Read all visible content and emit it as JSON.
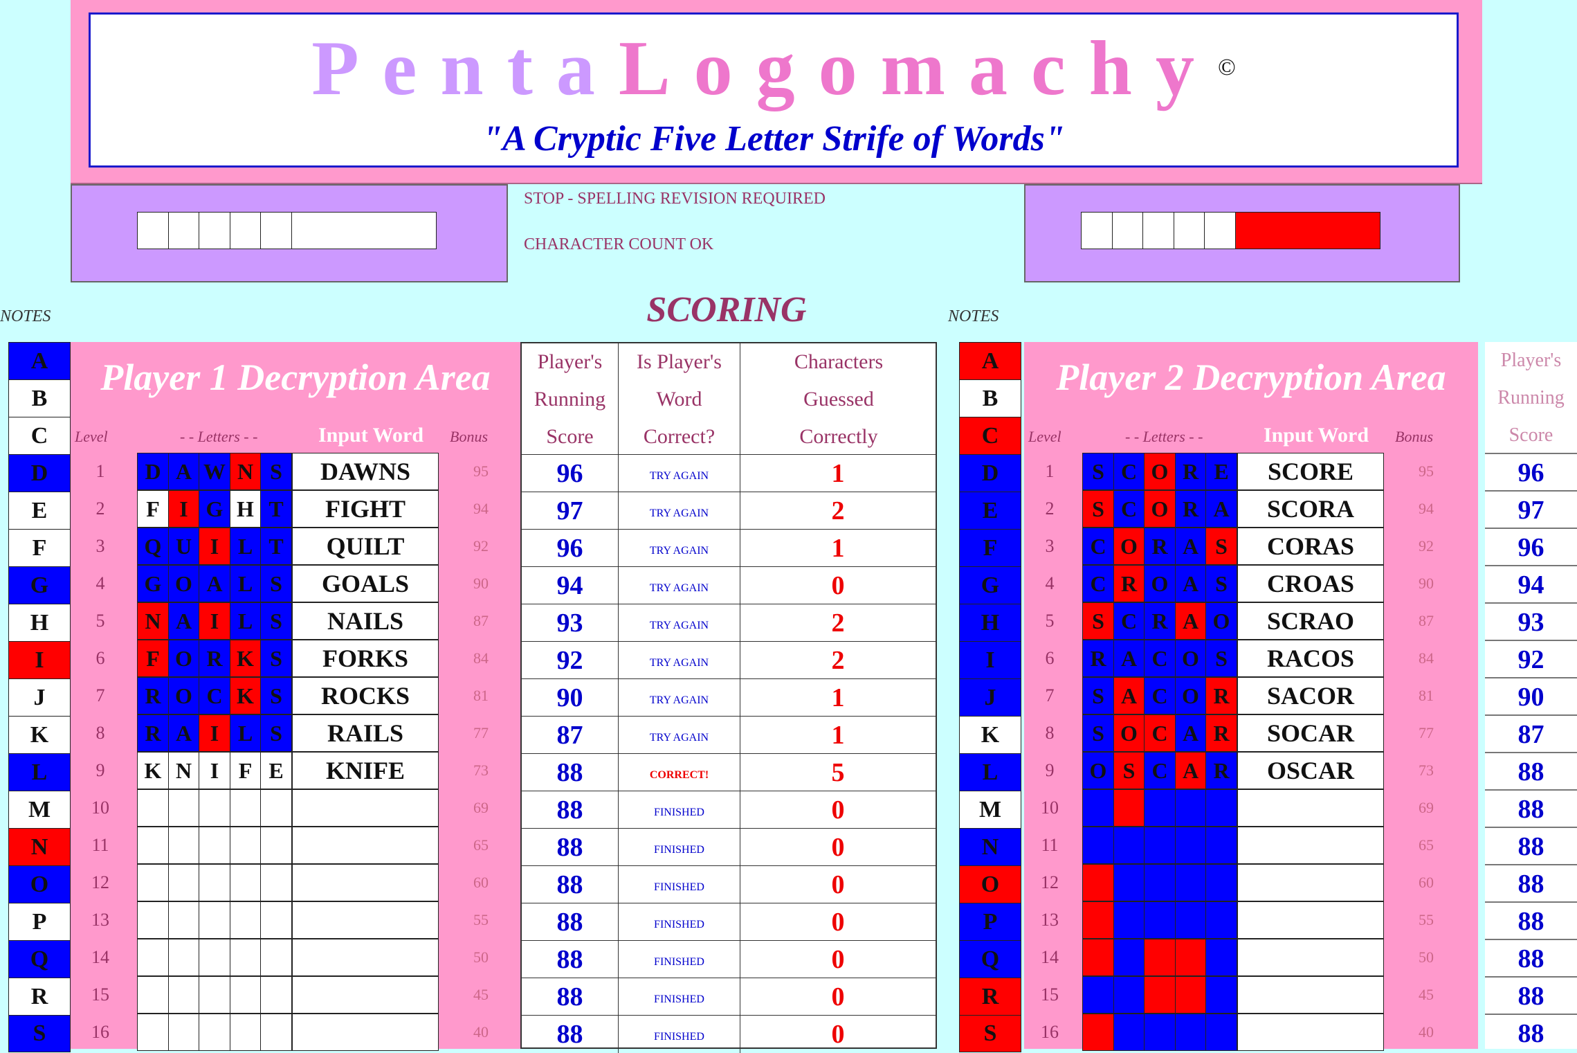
{
  "banner": {
    "title_part1": "Penta",
    "title_part2": "Logomachy",
    "copyright": "©",
    "subtitle": "\"A Cryptic Five Letter Strife of Words\""
  },
  "status": {
    "line1": "STOP - SPELLING REVISION REQUIRED",
    "line2": "CHARACTER COUNT OK"
  },
  "labels": {
    "notes": "NOTES",
    "scoring": "SCORING",
    "level": "Level",
    "letters": "- - Letters - -",
    "input_word": "Input Word",
    "bonus": "Bonus"
  },
  "player1": {
    "title": "Player 1 Decryption Area",
    "alphabet": [
      {
        "l": "A",
        "c": "blue"
      },
      {
        "l": "B",
        "c": "white"
      },
      {
        "l": "C",
        "c": "white"
      },
      {
        "l": "D",
        "c": "blue"
      },
      {
        "l": "E",
        "c": "white"
      },
      {
        "l": "F",
        "c": "white"
      },
      {
        "l": "G",
        "c": "blue"
      },
      {
        "l": "H",
        "c": "white"
      },
      {
        "l": "I",
        "c": "red"
      },
      {
        "l": "J",
        "c": "white"
      },
      {
        "l": "K",
        "c": "white"
      },
      {
        "l": "L",
        "c": "blue"
      },
      {
        "l": "M",
        "c": "white"
      },
      {
        "l": "N",
        "c": "red"
      },
      {
        "l": "O",
        "c": "blue"
      },
      {
        "l": "P",
        "c": "white"
      },
      {
        "l": "Q",
        "c": "blue"
      },
      {
        "l": "R",
        "c": "white"
      },
      {
        "l": "S",
        "c": "blue"
      }
    ],
    "rows": [
      {
        "level": "1",
        "letters": [
          [
            "D",
            "b"
          ],
          [
            "A",
            "b"
          ],
          [
            "W",
            "b"
          ],
          [
            "N",
            "r"
          ],
          [
            "S",
            "b"
          ]
        ],
        "word": "DAWNS",
        "bonus": "95"
      },
      {
        "level": "2",
        "letters": [
          [
            "F",
            "w"
          ],
          [
            "I",
            "r"
          ],
          [
            "G",
            "b"
          ],
          [
            "H",
            "w"
          ],
          [
            "T",
            "b"
          ]
        ],
        "word": "FIGHT",
        "bonus": "94"
      },
      {
        "level": "3",
        "letters": [
          [
            "Q",
            "b"
          ],
          [
            "U",
            "b"
          ],
          [
            "I",
            "r"
          ],
          [
            "L",
            "b"
          ],
          [
            "T",
            "b"
          ]
        ],
        "word": "QUILT",
        "bonus": "92"
      },
      {
        "level": "4",
        "letters": [
          [
            "G",
            "b"
          ],
          [
            "O",
            "b"
          ],
          [
            "A",
            "b"
          ],
          [
            "L",
            "b"
          ],
          [
            "S",
            "b"
          ]
        ],
        "word": "GOALS",
        "bonus": "90"
      },
      {
        "level": "5",
        "letters": [
          [
            "N",
            "r"
          ],
          [
            "A",
            "b"
          ],
          [
            "I",
            "r"
          ],
          [
            "L",
            "b"
          ],
          [
            "S",
            "b"
          ]
        ],
        "word": "NAILS",
        "bonus": "87"
      },
      {
        "level": "6",
        "letters": [
          [
            "F",
            "r"
          ],
          [
            "O",
            "b"
          ],
          [
            "R",
            "b"
          ],
          [
            "K",
            "r"
          ],
          [
            "S",
            "b"
          ]
        ],
        "word": "FORKS",
        "bonus": "84"
      },
      {
        "level": "7",
        "letters": [
          [
            "R",
            "b"
          ],
          [
            "O",
            "b"
          ],
          [
            "C",
            "b"
          ],
          [
            "K",
            "r"
          ],
          [
            "S",
            "b"
          ]
        ],
        "word": "ROCKS",
        "bonus": "81"
      },
      {
        "level": "8",
        "letters": [
          [
            "R",
            "b"
          ],
          [
            "A",
            "b"
          ],
          [
            "I",
            "r"
          ],
          [
            "L",
            "b"
          ],
          [
            "S",
            "b"
          ]
        ],
        "word": "RAILS",
        "bonus": "77"
      },
      {
        "level": "9",
        "letters": [
          [
            "K",
            "w"
          ],
          [
            "N",
            "w"
          ],
          [
            "I",
            "w"
          ],
          [
            "F",
            "w"
          ],
          [
            "E",
            "w"
          ]
        ],
        "word": "KNIFE",
        "bonus": "73"
      },
      {
        "level": "10",
        "letters": [
          [
            "",
            "w"
          ],
          [
            "",
            "w"
          ],
          [
            "",
            "w"
          ],
          [
            "",
            "w"
          ],
          [
            "",
            "w"
          ]
        ],
        "word": "",
        "bonus": "69"
      },
      {
        "level": "11",
        "letters": [
          [
            "",
            "w"
          ],
          [
            "",
            "w"
          ],
          [
            "",
            "w"
          ],
          [
            "",
            "w"
          ],
          [
            "",
            "w"
          ]
        ],
        "word": "",
        "bonus": "65"
      },
      {
        "level": "12",
        "letters": [
          [
            "",
            "w"
          ],
          [
            "",
            "w"
          ],
          [
            "",
            "w"
          ],
          [
            "",
            "w"
          ],
          [
            "",
            "w"
          ]
        ],
        "word": "",
        "bonus": "60"
      },
      {
        "level": "13",
        "letters": [
          [
            "",
            "w"
          ],
          [
            "",
            "w"
          ],
          [
            "",
            "w"
          ],
          [
            "",
            "w"
          ],
          [
            "",
            "w"
          ]
        ],
        "word": "",
        "bonus": "55"
      },
      {
        "level": "14",
        "letters": [
          [
            "",
            "w"
          ],
          [
            "",
            "w"
          ],
          [
            "",
            "w"
          ],
          [
            "",
            "w"
          ],
          [
            "",
            "w"
          ]
        ],
        "word": "",
        "bonus": "50"
      },
      {
        "level": "15",
        "letters": [
          [
            "",
            "w"
          ],
          [
            "",
            "w"
          ],
          [
            "",
            "w"
          ],
          [
            "",
            "w"
          ],
          [
            "",
            "w"
          ]
        ],
        "word": "",
        "bonus": "45"
      },
      {
        "level": "16",
        "letters": [
          [
            "",
            "w"
          ],
          [
            "",
            "w"
          ],
          [
            "",
            "w"
          ],
          [
            "",
            "w"
          ],
          [
            "",
            "w"
          ]
        ],
        "word": "",
        "bonus": "40"
      }
    ]
  },
  "score_table": {
    "headers": [
      "Player's Running Score",
      "Is Player's Word Correct?",
      "Characters Guessed Correctly"
    ],
    "header_lines": [
      [
        "Player's",
        "Running",
        "Score"
      ],
      [
        "Is Player's",
        "Word",
        "Correct?"
      ],
      [
        "Characters",
        "Guessed",
        "Correctly"
      ]
    ],
    "rows": [
      {
        "score": "96",
        "status": "TRY AGAIN",
        "kind": "try",
        "count": "1"
      },
      {
        "score": "97",
        "status": "TRY AGAIN",
        "kind": "try",
        "count": "2"
      },
      {
        "score": "96",
        "status": "TRY AGAIN",
        "kind": "try",
        "count": "1"
      },
      {
        "score": "94",
        "status": "TRY AGAIN",
        "kind": "try",
        "count": "0"
      },
      {
        "score": "93",
        "status": "TRY AGAIN",
        "kind": "try",
        "count": "2"
      },
      {
        "score": "92",
        "status": "TRY AGAIN",
        "kind": "try",
        "count": "2"
      },
      {
        "score": "90",
        "status": "TRY AGAIN",
        "kind": "try",
        "count": "1"
      },
      {
        "score": "87",
        "status": "TRY AGAIN",
        "kind": "try",
        "count": "1"
      },
      {
        "score": "88",
        "status": "CORRECT!",
        "kind": "cor",
        "count": "5"
      },
      {
        "score": "88",
        "status": "FINISHED",
        "kind": "fin",
        "count": "0"
      },
      {
        "score": "88",
        "status": "FINISHED",
        "kind": "fin",
        "count": "0"
      },
      {
        "score": "88",
        "status": "FINISHED",
        "kind": "fin",
        "count": "0"
      },
      {
        "score": "88",
        "status": "FINISHED",
        "kind": "fin",
        "count": "0"
      },
      {
        "score": "88",
        "status": "FINISHED",
        "kind": "fin",
        "count": "0"
      },
      {
        "score": "88",
        "status": "FINISHED",
        "kind": "fin",
        "count": "0"
      },
      {
        "score": "88",
        "status": "FINISHED",
        "kind": "fin",
        "count": "0"
      }
    ]
  },
  "player2": {
    "title": "Player 2 Decryption Area",
    "alphabet": [
      {
        "l": "A",
        "c": "red"
      },
      {
        "l": "B",
        "c": "white"
      },
      {
        "l": "C",
        "c": "red"
      },
      {
        "l": "D",
        "c": "blue"
      },
      {
        "l": "E",
        "c": "blue"
      },
      {
        "l": "F",
        "c": "blue"
      },
      {
        "l": "G",
        "c": "blue"
      },
      {
        "l": "H",
        "c": "blue"
      },
      {
        "l": "I",
        "c": "blue"
      },
      {
        "l": "J",
        "c": "blue"
      },
      {
        "l": "K",
        "c": "white"
      },
      {
        "l": "L",
        "c": "blue"
      },
      {
        "l": "M",
        "c": "white"
      },
      {
        "l": "N",
        "c": "blue"
      },
      {
        "l": "O",
        "c": "red"
      },
      {
        "l": "P",
        "c": "blue"
      },
      {
        "l": "Q",
        "c": "blue"
      },
      {
        "l": "R",
        "c": "red"
      },
      {
        "l": "S",
        "c": "red"
      }
    ],
    "rows": [
      {
        "level": "1",
        "letters": [
          [
            "S",
            "b"
          ],
          [
            "C",
            "b"
          ],
          [
            "O",
            "r"
          ],
          [
            "R",
            "b"
          ],
          [
            "E",
            "b"
          ]
        ],
        "word": "SCORE",
        "bonus": "95"
      },
      {
        "level": "2",
        "letters": [
          [
            "S",
            "r"
          ],
          [
            "C",
            "b"
          ],
          [
            "O",
            "r"
          ],
          [
            "R",
            "b"
          ],
          [
            "A",
            "b"
          ]
        ],
        "word": "SCORA",
        "bonus": "94"
      },
      {
        "level": "3",
        "letters": [
          [
            "C",
            "b"
          ],
          [
            "O",
            "r"
          ],
          [
            "R",
            "b"
          ],
          [
            "A",
            "b"
          ],
          [
            "S",
            "r"
          ]
        ],
        "word": "CORAS",
        "bonus": "92"
      },
      {
        "level": "4",
        "letters": [
          [
            "C",
            "b"
          ],
          [
            "R",
            "r"
          ],
          [
            "O",
            "b"
          ],
          [
            "A",
            "b"
          ],
          [
            "S",
            "b"
          ]
        ],
        "word": "CROAS",
        "bonus": "90"
      },
      {
        "level": "5",
        "letters": [
          [
            "S",
            "r"
          ],
          [
            "C",
            "b"
          ],
          [
            "R",
            "b"
          ],
          [
            "A",
            "r"
          ],
          [
            "O",
            "b"
          ]
        ],
        "word": "SCRAO",
        "bonus": "87"
      },
      {
        "level": "6",
        "letters": [
          [
            "R",
            "b"
          ],
          [
            "A",
            "b"
          ],
          [
            "C",
            "b"
          ],
          [
            "O",
            "b"
          ],
          [
            "S",
            "b"
          ]
        ],
        "word": "RACOS",
        "bonus": "84"
      },
      {
        "level": "7",
        "letters": [
          [
            "S",
            "b"
          ],
          [
            "A",
            "r"
          ],
          [
            "C",
            "b"
          ],
          [
            "O",
            "b"
          ],
          [
            "R",
            "r"
          ]
        ],
        "word": "SACOR",
        "bonus": "81"
      },
      {
        "level": "8",
        "letters": [
          [
            "S",
            "b"
          ],
          [
            "O",
            "r"
          ],
          [
            "C",
            "r"
          ],
          [
            "A",
            "b"
          ],
          [
            "R",
            "r"
          ]
        ],
        "word": "SOCAR",
        "bonus": "77"
      },
      {
        "level": "9",
        "letters": [
          [
            "O",
            "b"
          ],
          [
            "S",
            "r"
          ],
          [
            "C",
            "b"
          ],
          [
            "A",
            "r"
          ],
          [
            "R",
            "b"
          ]
        ],
        "word": "OSCAR",
        "bonus": "73"
      },
      {
        "level": "10",
        "letters": [
          [
            "",
            "b"
          ],
          [
            "",
            "r"
          ],
          [
            "",
            "b"
          ],
          [
            "",
            "b"
          ],
          [
            "",
            "b"
          ]
        ],
        "word": "",
        "bonus": "69"
      },
      {
        "level": "11",
        "letters": [
          [
            "",
            "b"
          ],
          [
            "",
            "b"
          ],
          [
            "",
            "b"
          ],
          [
            "",
            "b"
          ],
          [
            "",
            "b"
          ]
        ],
        "word": "",
        "bonus": "65"
      },
      {
        "level": "12",
        "letters": [
          [
            "",
            "r"
          ],
          [
            "",
            "b"
          ],
          [
            "",
            "b"
          ],
          [
            "",
            "b"
          ],
          [
            "",
            "b"
          ]
        ],
        "word": "",
        "bonus": "60"
      },
      {
        "level": "13",
        "letters": [
          [
            "",
            "r"
          ],
          [
            "",
            "b"
          ],
          [
            "",
            "b"
          ],
          [
            "",
            "b"
          ],
          [
            "",
            "b"
          ]
        ],
        "word": "",
        "bonus": "55"
      },
      {
        "level": "14",
        "letters": [
          [
            "",
            "r"
          ],
          [
            "",
            "b"
          ],
          [
            "",
            "r"
          ],
          [
            "",
            "r"
          ],
          [
            "",
            "b"
          ]
        ],
        "word": "",
        "bonus": "50"
      },
      {
        "level": "15",
        "letters": [
          [
            "",
            "b"
          ],
          [
            "",
            "b"
          ],
          [
            "",
            "r"
          ],
          [
            "",
            "r"
          ],
          [
            "",
            "b"
          ]
        ],
        "word": "",
        "bonus": "45"
      },
      {
        "level": "16",
        "letters": [
          [
            "",
            "r"
          ],
          [
            "",
            "b"
          ],
          [
            "",
            "b"
          ],
          [
            "",
            "b"
          ],
          [
            "",
            "b"
          ]
        ],
        "word": "",
        "bonus": "40"
      }
    ],
    "running_header": [
      "Player's",
      "Running",
      "Score"
    ],
    "running_scores": [
      "96",
      "97",
      "96",
      "94",
      "93",
      "92",
      "90",
      "87",
      "88",
      "88",
      "88",
      "88",
      "88",
      "88",
      "88",
      "88"
    ]
  },
  "colors": {
    "blue": "#0000ff",
    "red": "#ff0000",
    "white": "#ffffff",
    "pink": "#ff99cc",
    "lavender": "#cc99ff",
    "background": "#ccffff"
  }
}
